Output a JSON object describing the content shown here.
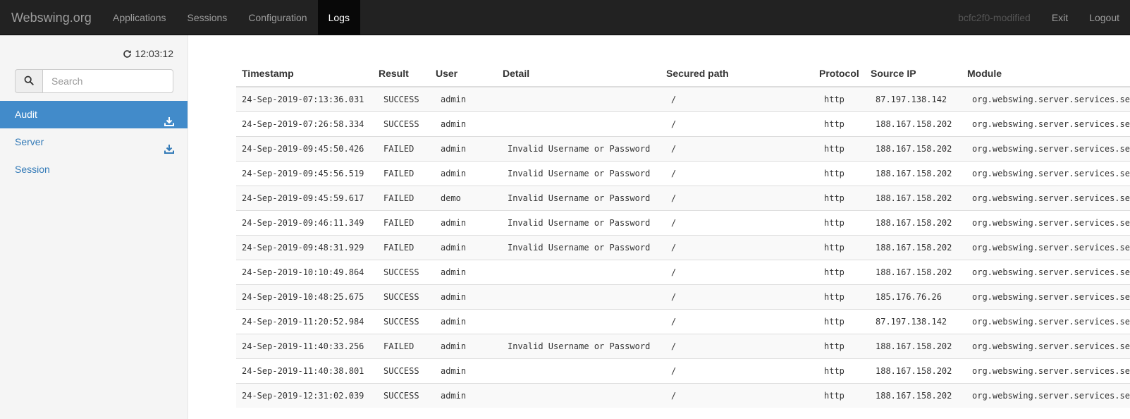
{
  "navbar": {
    "brand": "Webswing.org",
    "left_items": [
      "Applications",
      "Sessions",
      "Configuration",
      "Logs"
    ],
    "active": "Logs",
    "version": "bcfc2f0-modified",
    "right_items": [
      "Exit",
      "Logout"
    ]
  },
  "sidebar": {
    "refresh_time": "12:03:12",
    "refresh_icon": "refresh-icon",
    "search_icon": "search-icon",
    "search": {
      "placeholder": "Search",
      "value": ""
    },
    "items": [
      {
        "label": "Audit",
        "active": true,
        "download_icon": "download-icon"
      },
      {
        "label": "Server",
        "active": false,
        "download_icon": "download-icon"
      },
      {
        "label": "Session",
        "active": false
      }
    ]
  },
  "table": {
    "columns": [
      "Timestamp",
      "Result",
      "User",
      "Detail",
      "Secured path",
      "Protocol",
      "Source IP",
      "Module"
    ],
    "rows": [
      [
        "24-Sep-2019-07:13:36.031",
        "SUCCESS",
        "admin",
        "",
        "/",
        "http",
        "87.197.138.142",
        "org.webswing.server.services.se"
      ],
      [
        "24-Sep-2019-07:26:58.334",
        "SUCCESS",
        "admin",
        "",
        "/",
        "http",
        "188.167.158.202",
        "org.webswing.server.services.se"
      ],
      [
        "24-Sep-2019-09:45:50.426",
        "FAILED",
        "admin",
        "Invalid Username or Password",
        "/",
        "http",
        "188.167.158.202",
        "org.webswing.server.services.se"
      ],
      [
        "24-Sep-2019-09:45:56.519",
        "FAILED",
        "admin",
        "Invalid Username or Password",
        "/",
        "http",
        "188.167.158.202",
        "org.webswing.server.services.se"
      ],
      [
        "24-Sep-2019-09:45:59.617",
        "FAILED",
        "demo",
        "Invalid Username or Password",
        "/",
        "http",
        "188.167.158.202",
        "org.webswing.server.services.se"
      ],
      [
        "24-Sep-2019-09:46:11.349",
        "FAILED",
        "admin",
        "Invalid Username or Password",
        "/",
        "http",
        "188.167.158.202",
        "org.webswing.server.services.se"
      ],
      [
        "24-Sep-2019-09:48:31.929",
        "FAILED",
        "admin",
        "Invalid Username or Password",
        "/",
        "http",
        "188.167.158.202",
        "org.webswing.server.services.se"
      ],
      [
        "24-Sep-2019-10:10:49.864",
        "SUCCESS",
        "admin",
        "",
        "/",
        "http",
        "188.167.158.202",
        "org.webswing.server.services.se"
      ],
      [
        "24-Sep-2019-10:48:25.675",
        "SUCCESS",
        "admin",
        "",
        "/",
        "http",
        "185.176.76.26",
        "org.webswing.server.services.se"
      ],
      [
        "24-Sep-2019-11:20:52.984",
        "SUCCESS",
        "admin",
        "",
        "/",
        "http",
        "87.197.138.142",
        "org.webswing.server.services.se"
      ],
      [
        "24-Sep-2019-11:40:33.256",
        "FAILED",
        "admin",
        "Invalid Username or Password",
        "/",
        "http",
        "188.167.158.202",
        "org.webswing.server.services.se"
      ],
      [
        "24-Sep-2019-11:40:38.801",
        "SUCCESS",
        "admin",
        "",
        "/",
        "http",
        "188.167.158.202",
        "org.webswing.server.services.se"
      ],
      [
        "24-Sep-2019-12:31:02.039",
        "SUCCESS",
        "admin",
        "",
        "/",
        "http",
        "188.167.158.202",
        "org.webswing.server.services.se"
      ]
    ]
  },
  "colors": {
    "navbar_bg": "#222222",
    "active_nav_bg": "#080808",
    "sidebar_active": "#428bca",
    "link": "#337ab7"
  }
}
